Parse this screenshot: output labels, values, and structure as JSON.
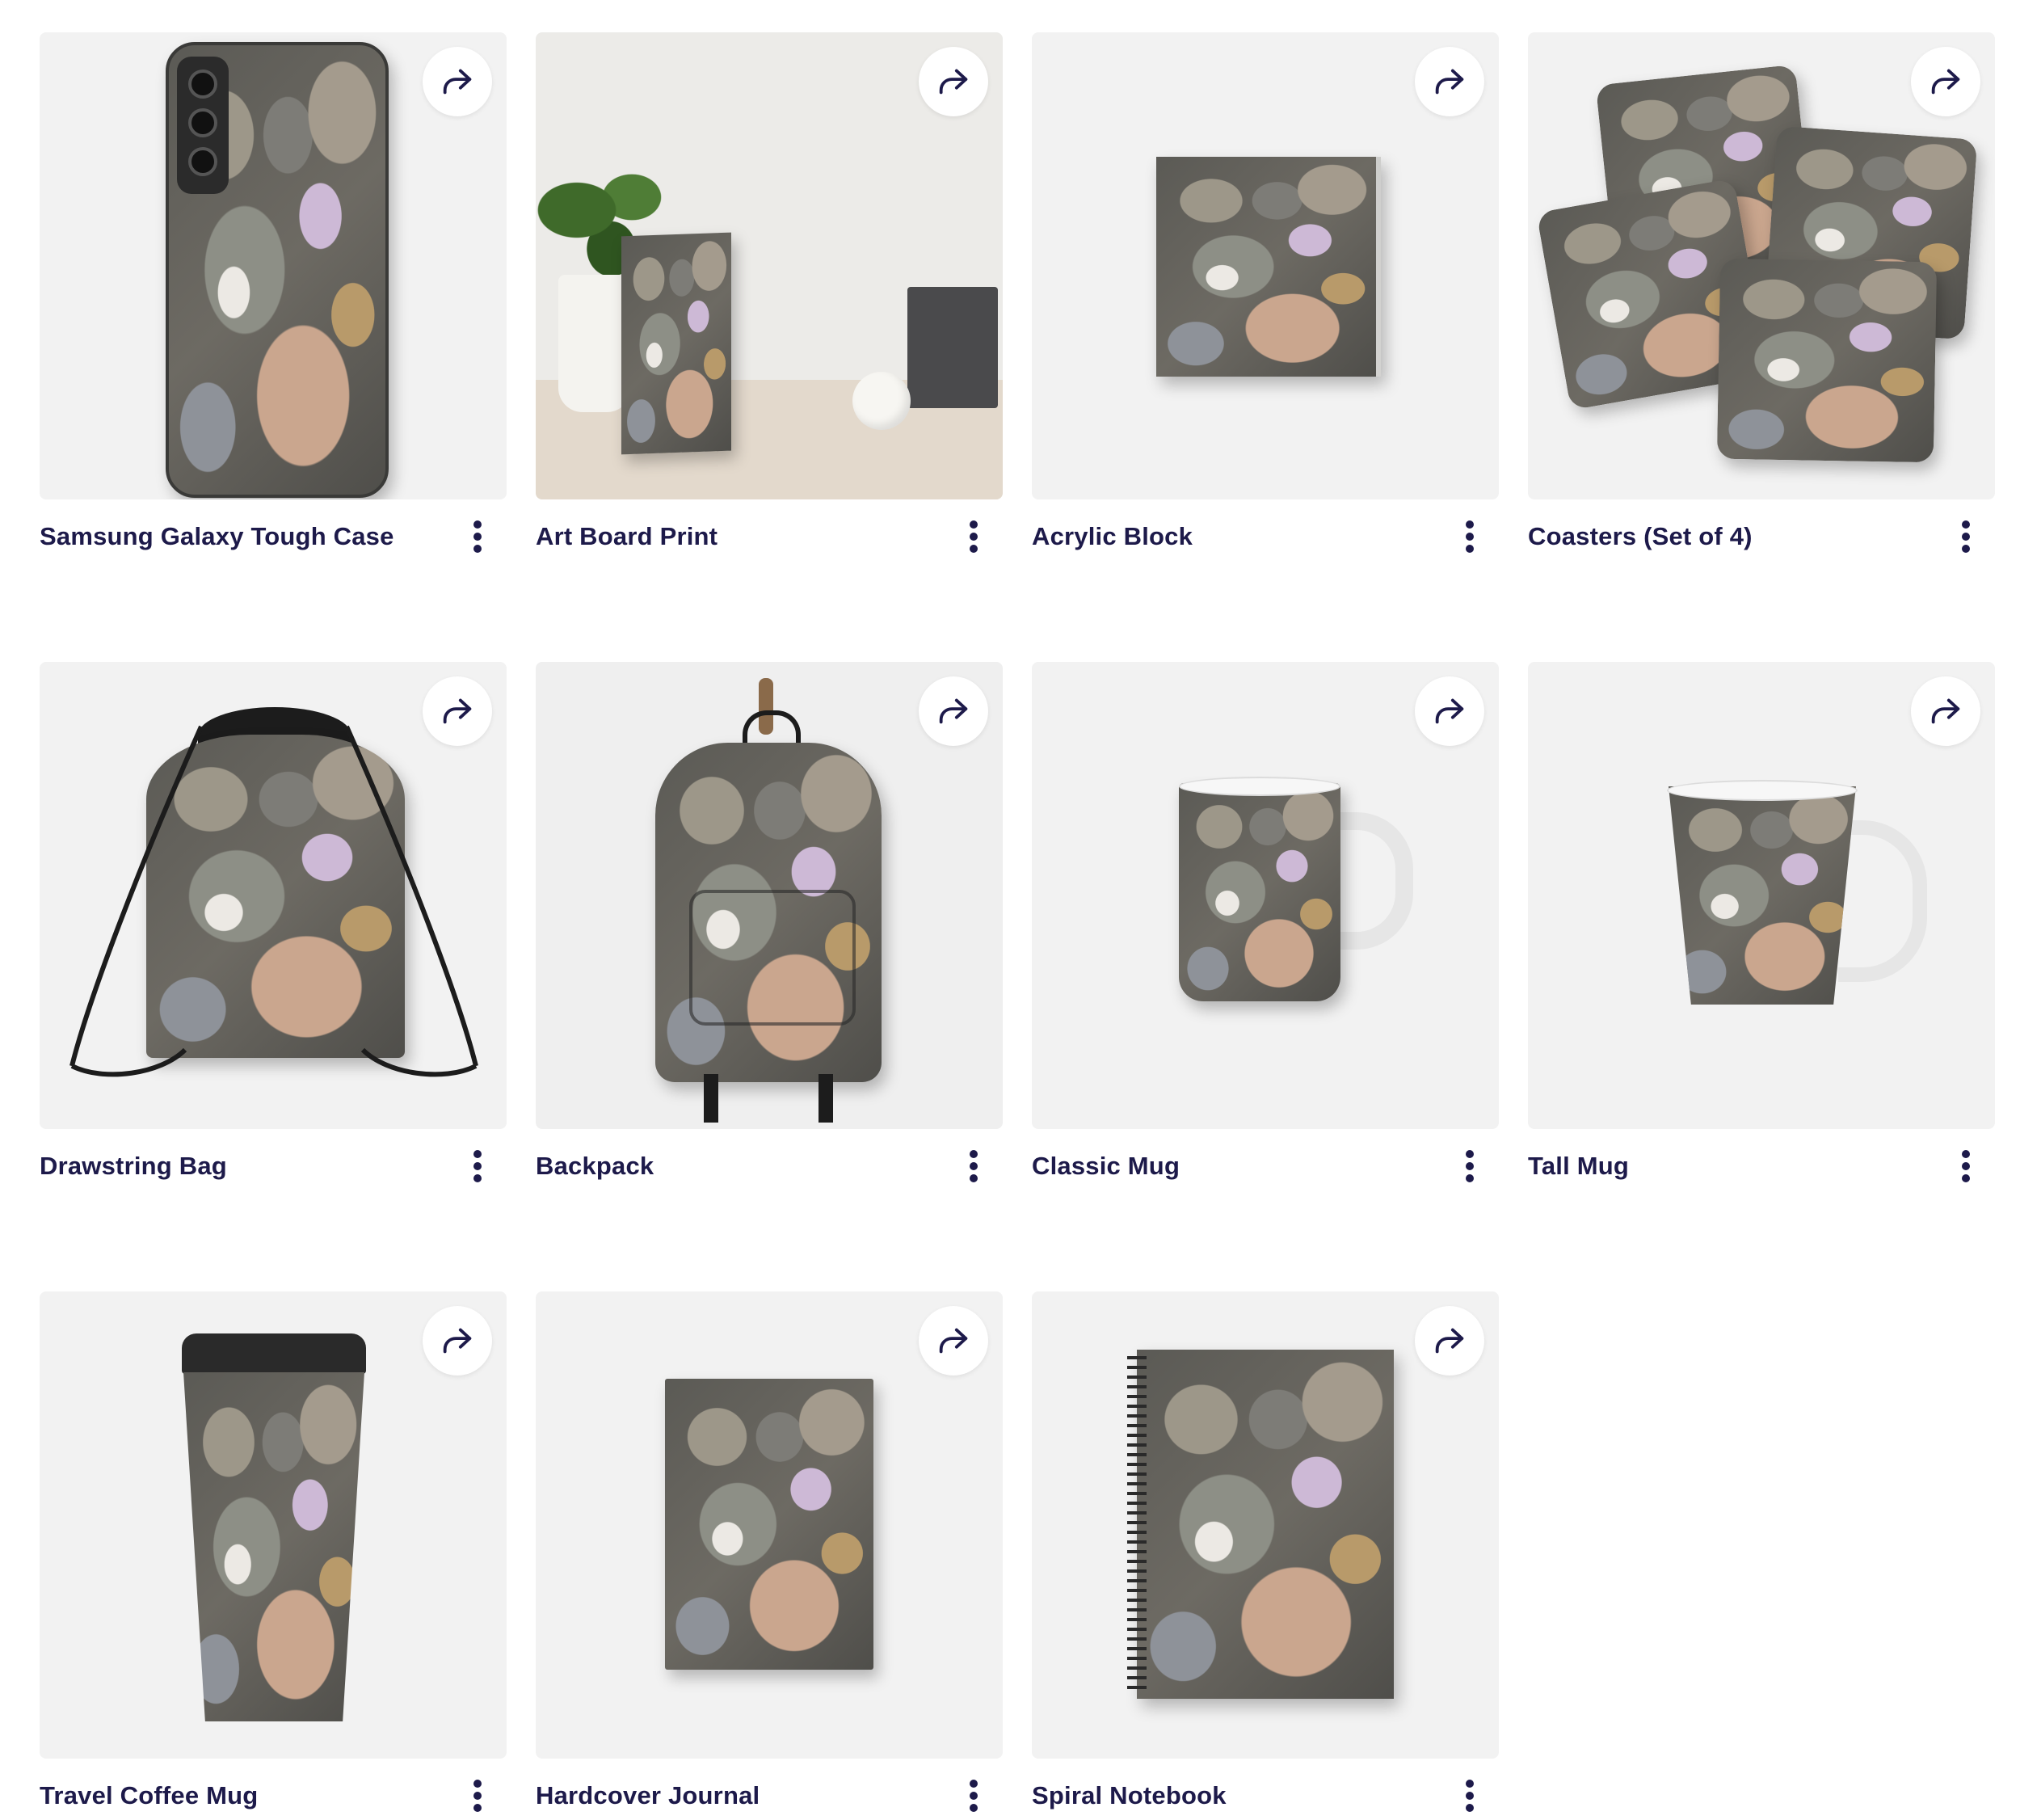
{
  "products": [
    {
      "title": "Samsung Galaxy Tough Case",
      "art": "phone"
    },
    {
      "title": "Art Board Print",
      "art": "artboard"
    },
    {
      "title": "Acrylic Block",
      "art": "acrylic"
    },
    {
      "title": "Coasters (Set of 4)",
      "art": "coasters"
    },
    {
      "title": "Drawstring Bag",
      "art": "drawstring"
    },
    {
      "title": "Backpack",
      "art": "backpack"
    },
    {
      "title": "Classic Mug",
      "art": "mug"
    },
    {
      "title": "Tall Mug",
      "art": "tallmug"
    },
    {
      "title": "Travel Coffee Mug",
      "art": "travelmug"
    },
    {
      "title": "Hardcover Journal",
      "art": "journal"
    },
    {
      "title": "Spiral Notebook",
      "art": "notebook"
    }
  ],
  "icons": {
    "share": "share-icon",
    "more": "more-vertical-icon"
  },
  "colors": {
    "text": "#1d1a4a",
    "card_bg": "#f2f2f2",
    "share_bg": "#ffffff"
  }
}
